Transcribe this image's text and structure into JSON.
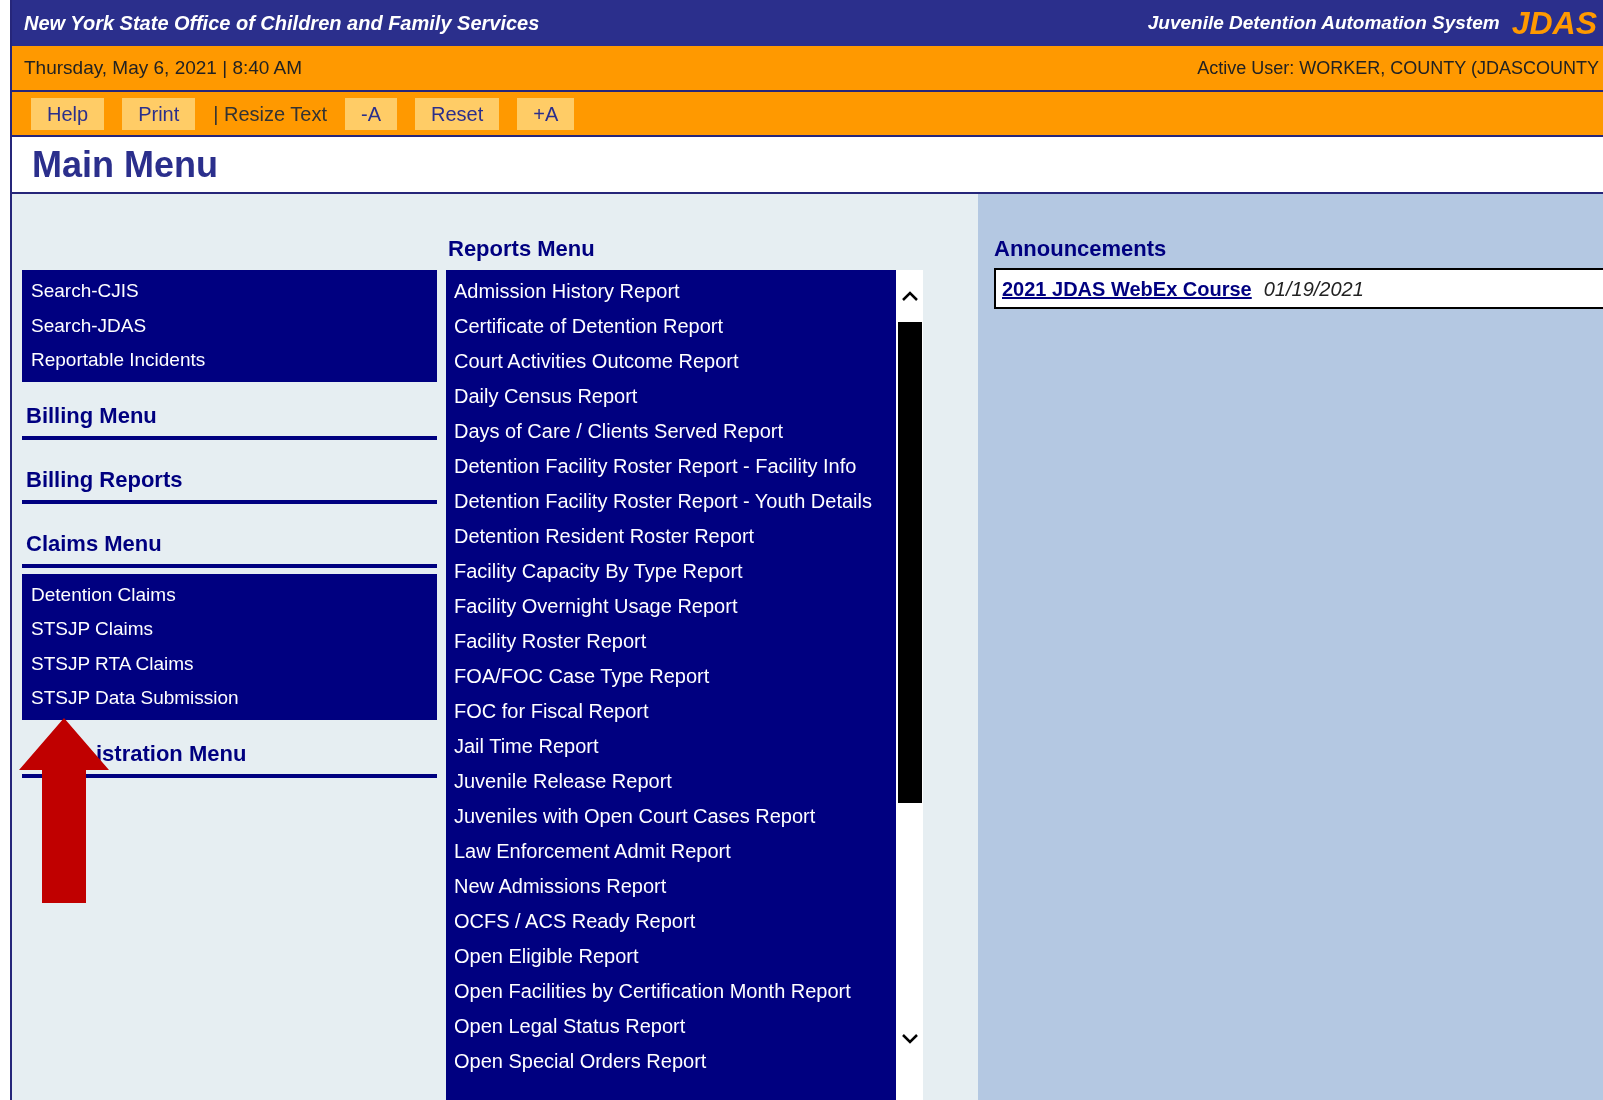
{
  "header": {
    "agency": "New York State Office of Children and Family Services",
    "system": "Juvenile Detention Automation System",
    "logo": "JDAS"
  },
  "status_bar": {
    "datetime": "Thursday, May 6, 2021 | 8:40 AM",
    "user": "Active User: WORKER, COUNTY (JDASCOUNTY"
  },
  "toolbar": [
    {
      "kind": "button",
      "label": "Help"
    },
    {
      "kind": "button",
      "label": "Print"
    },
    {
      "kind": "label",
      "label": "| Resize Text"
    },
    {
      "kind": "button",
      "label": "-A"
    },
    {
      "kind": "button",
      "label": "Reset"
    },
    {
      "kind": "button",
      "label": "+A"
    }
  ],
  "page_title": "Main Menu",
  "left_menu": [
    {
      "kind": "links",
      "items": [
        "Search-CJIS",
        "Search-JDAS",
        "Reportable Incidents"
      ]
    },
    {
      "kind": "heading",
      "label": "Billing Menu"
    },
    {
      "kind": "heading",
      "label": "Billing Reports"
    },
    {
      "kind": "heading",
      "label": "Claims Menu"
    },
    {
      "kind": "links",
      "items": [
        "Detention Claims",
        "STSJP Claims",
        "STSJP RTA Claims",
        "STSJP Data Submission"
      ]
    },
    {
      "kind": "heading",
      "label": "istration Menu"
    }
  ],
  "reports_menu": {
    "title": "Reports Menu",
    "items": [
      "Admission History Report",
      "Certificate of Detention Report",
      "Court Activities Outcome Report",
      "Daily Census Report",
      "Days of Care / Clients Served Report",
      "Detention Facility Roster Report - Facility Info",
      "Detention Facility Roster Report - Youth Details",
      "Detention Resident Roster Report",
      "Facility Capacity By Type Report",
      "Facility Overnight Usage Report",
      "Facility Roster Report",
      "FOA/FOC Case Type Report",
      "FOC for Fiscal Report",
      "Jail Time Report",
      "Juvenile Release Report",
      "Juveniles with Open Court Cases Report",
      "Law Enforcement Admit Report",
      "New Admissions Report",
      "OCFS / ACS Ready Report",
      "Open Eligible Report",
      "Open Facilities by Certification Month Report",
      "Open Legal Status Report",
      "Open Special Orders Report"
    ]
  },
  "announcements": {
    "title": "Announcements",
    "items": [
      {
        "link": "2021 JDAS WebEx Course",
        "date": "01/19/2021"
      }
    ]
  }
}
